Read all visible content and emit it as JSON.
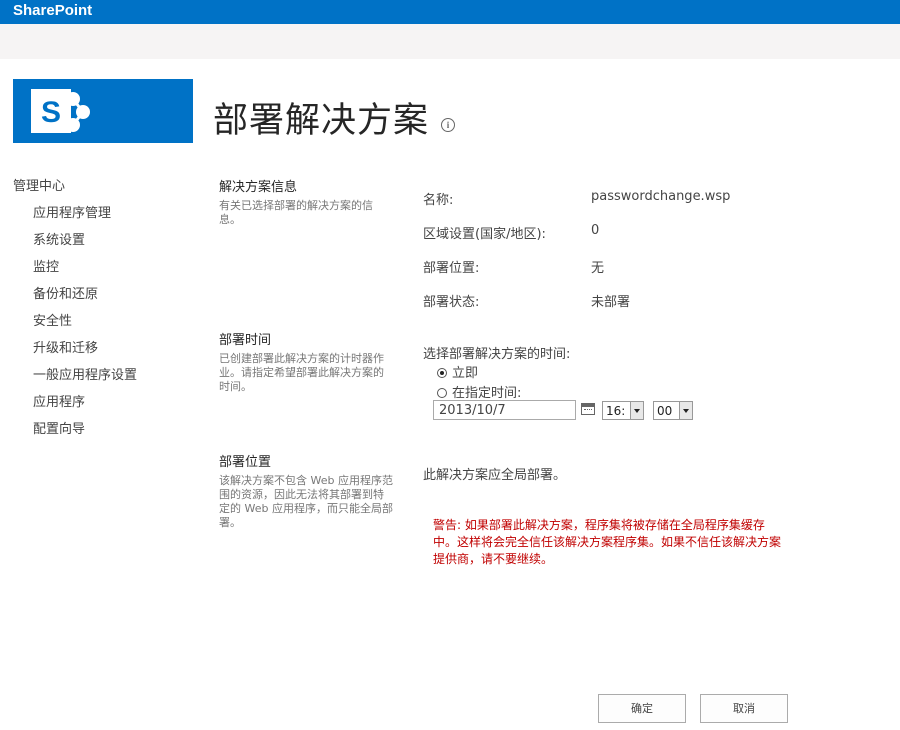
{
  "suite_bar": {
    "brand": "SharePoint"
  },
  "page": {
    "title": "部署解决方案",
    "info_icon": "info-icon"
  },
  "nav": {
    "heading": "管理中心",
    "items": [
      {
        "label": "应用程序管理"
      },
      {
        "label": "系统设置"
      },
      {
        "label": "监控"
      },
      {
        "label": "备份和还原"
      },
      {
        "label": "安全性"
      },
      {
        "label": "升级和迁移"
      },
      {
        "label": "一般应用程序设置"
      },
      {
        "label": "应用程序"
      },
      {
        "label": "配置向导"
      }
    ]
  },
  "sections": {
    "info": {
      "title": "解决方案信息",
      "desc": "有关已选择部署的解决方案的信息。",
      "props": [
        {
          "label": "名称:",
          "value": "passwordchange.wsp"
        },
        {
          "label": "区域设置(国家/地区):",
          "value": "0"
        },
        {
          "label": "部署位置:",
          "value": "无"
        },
        {
          "label": "部署状态:",
          "value": "未部署"
        }
      ]
    },
    "time": {
      "title": "部署时间",
      "desc": "已创建部署此解决方案的计时器作业。请指定希望部署此解决方案的时间。",
      "prompt": "选择部署解决方案的时间:",
      "option_now": "立即",
      "option_specific": "在指定时间:",
      "selected": "立即",
      "date_value": "2013/10/7",
      "hour_value": "16:",
      "minute_value": "00"
    },
    "location": {
      "title": "部署位置",
      "desc": "该解决方案不包含 Web 应用程序范围的资源，因此无法将其部署到特定的 Web 应用程序，而只能全局部署。",
      "note": "此解决方案应全局部署。",
      "warning": "警告: 如果部署此解决方案，程序集将被存储在全局程序集缓存中。这样将会完全信任该解决方案程序集。如果不信任该解决方案提供商，请不要继续。"
    }
  },
  "buttons": {
    "ok": "确定",
    "cancel": "取消"
  },
  "colors": {
    "brand_blue": "#0072c6",
    "warning_red": "#c00000"
  }
}
